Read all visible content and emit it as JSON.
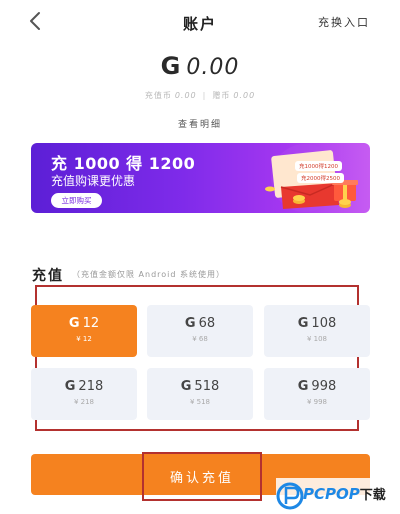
{
  "header": {
    "title": "账户",
    "switch_entry": "充换入口"
  },
  "balance": {
    "currency_icon": "G",
    "amount": "0.00"
  },
  "sub_balance": {
    "recharge_label": "充值币",
    "recharge_value": "0.00",
    "gift_label": "赠币",
    "gift_value": "0.00"
  },
  "detail_link": "查看明细",
  "banner": {
    "title": "充 1000 得 1200",
    "subtitle": "充值购课更优惠",
    "button": "立即购买",
    "card_notes": [
      "充1000得1200",
      "充2000得2500"
    ]
  },
  "recharge_section": {
    "title": "充值",
    "note": "（充值金额仅限 Android 系统使用）"
  },
  "packages": [
    {
      "coins": "12",
      "price": "¥ 12",
      "selected": true
    },
    {
      "coins": "68",
      "price": "¥ 68",
      "selected": false
    },
    {
      "coins": "108",
      "price": "¥ 108",
      "selected": false
    },
    {
      "coins": "218",
      "price": "¥ 218",
      "selected": false
    },
    {
      "coins": "518",
      "price": "¥ 518",
      "selected": false
    },
    {
      "coins": "998",
      "price": "¥ 998",
      "selected": false
    }
  ],
  "confirm_button": "确认充值",
  "watermark": {
    "brand": "PCPOP",
    "suffix": "下载"
  },
  "colors": {
    "accent_orange": "#f5821f",
    "banner_purple": "#7f2bea",
    "highlight_red": "#b3312f",
    "package_bg": "#eff2f8",
    "watermark_blue": "#1e88e5"
  },
  "icons": [
    "back-arrow-icon",
    "coin-icon",
    "gift-box-icon",
    "coin-stack-icon"
  ]
}
